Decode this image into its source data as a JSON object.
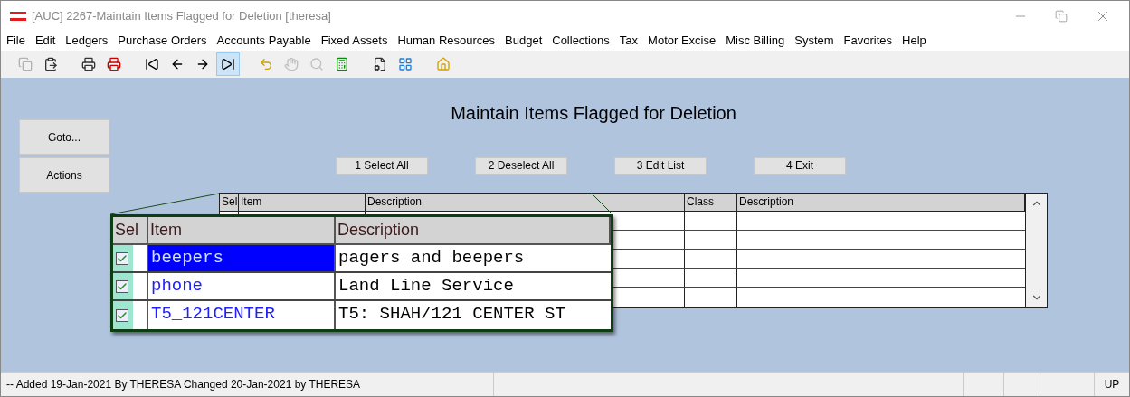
{
  "window": {
    "title": "[AUC] 2267-Maintain Items Flagged for Deletion [theresa]"
  },
  "menu": [
    "File",
    "Edit",
    "Ledgers",
    "Purchase Orders",
    "Accounts Payable",
    "Fixed Assets",
    "Human Resources",
    "Budget",
    "Collections",
    "Tax",
    "Motor Excise",
    "Misc Billing",
    "System",
    "Favorites",
    "Help"
  ],
  "toolbar": [
    {
      "kind": "copy",
      "disabled": true,
      "selected": false
    },
    {
      "kind": "paste",
      "disabled": false,
      "selected": false
    },
    {
      "kind": "gap"
    },
    {
      "kind": "print",
      "disabled": false,
      "selected": false
    },
    {
      "kind": "print-to",
      "disabled": false,
      "selected": false
    },
    {
      "kind": "gap"
    },
    {
      "kind": "first",
      "disabled": false,
      "selected": false
    },
    {
      "kind": "prev",
      "disabled": false,
      "selected": false
    },
    {
      "kind": "next",
      "disabled": false,
      "selected": false
    },
    {
      "kind": "last",
      "disabled": false,
      "selected": true
    },
    {
      "kind": "gap"
    },
    {
      "kind": "back",
      "disabled": false,
      "selected": false
    },
    {
      "kind": "hand",
      "disabled": true,
      "selected": false
    },
    {
      "kind": "search",
      "disabled": true,
      "selected": false
    },
    {
      "kind": "calc",
      "disabled": false,
      "selected": false
    },
    {
      "kind": "gap"
    },
    {
      "kind": "props",
      "disabled": false,
      "selected": false
    },
    {
      "kind": "squares",
      "disabled": false,
      "selected": false
    },
    {
      "kind": "gap"
    },
    {
      "kind": "home",
      "disabled": false,
      "selected": false
    }
  ],
  "side_buttons": [
    "Goto...",
    "Actions"
  ],
  "heading": "Maintain Items Flagged for Deletion",
  "action_buttons": [
    "1 Select All",
    "2 Deselect All",
    "3 Edit List",
    "4 Exit"
  ],
  "table": {
    "columns": [
      "Sel",
      "Item",
      "Description",
      "Class",
      "Description"
    ]
  },
  "callout": {
    "columns": [
      "Sel",
      "Item",
      "Description"
    ],
    "rows": [
      {
        "checked": true,
        "item": "beepers",
        "description": "pagers and beepers",
        "selected": true
      },
      {
        "checked": true,
        "item": "phone",
        "description": "Land Line Service",
        "selected": false
      },
      {
        "checked": true,
        "item": "T5_121CENTER",
        "description": "T5: SHAH/121 CENTER ST",
        "selected": false
      }
    ]
  },
  "status_bar": {
    "message": "-- Added 19-Jan-2021 By THERESA Changed 20-Jan-2021 by THERESA",
    "mode": "UP"
  }
}
